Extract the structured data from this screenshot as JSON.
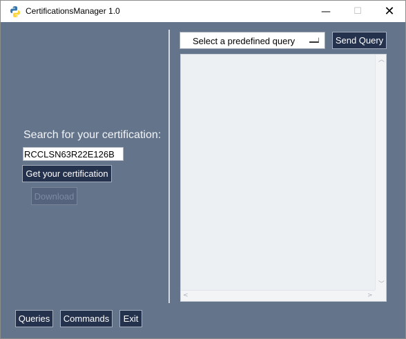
{
  "window": {
    "title": "CertificationsManager 1.0",
    "minimize_glyph": "—",
    "maximize_glyph": "☐",
    "close_glyph": "✕"
  },
  "search": {
    "label": "Search for your certification:",
    "value": "RCCLSN63R22E126B",
    "get_button": "Get your certification",
    "download_button": "Download"
  },
  "query": {
    "selected": "Select a predefined query",
    "send_button": "Send Query",
    "results_text": ""
  },
  "scroll_glyphs": {
    "up": "︿",
    "down": "﹀",
    "left": "<",
    "right": ">"
  },
  "bottom_buttons": {
    "queries": "Queries",
    "commands": "Commands",
    "exit": "Exit"
  },
  "colors": {
    "background": "#64748b",
    "button": "#24324d",
    "button_disabled": "#55647c",
    "text_area": "#edf0f3"
  },
  "icons": {
    "app": "python-logo-icon"
  }
}
